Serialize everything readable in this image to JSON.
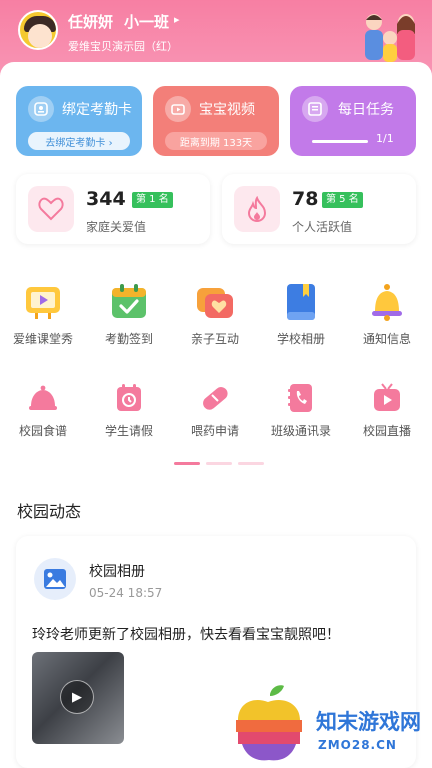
{
  "user": {
    "name": "任妍妍",
    "class": "小一班",
    "class_arrow": "▸",
    "school": "爱维宝贝演示园（红）"
  },
  "cards": [
    {
      "title": "绑定考勤卡",
      "sub": "去绑定考勤卡 ›",
      "icon": "attendance-card-icon"
    },
    {
      "title": "宝宝视频",
      "sub": "距离到期 133天",
      "icon": "video-icon"
    },
    {
      "title": "每日任务",
      "progress_text": "1/1",
      "icon": "task-icon"
    }
  ],
  "stats": [
    {
      "value": "344",
      "rank": "第 1 名",
      "label": "家庭关爱值"
    },
    {
      "value": "78",
      "rank": "第 5 名",
      "label": "个人活跃值"
    }
  ],
  "grid": [
    {
      "label": "爱维课堂秀",
      "icon": "classroom-show-icon"
    },
    {
      "label": "考勤签到",
      "icon": "attendance-calendar-icon"
    },
    {
      "label": "亲子互动",
      "icon": "chat-heart-icon"
    },
    {
      "label": "学校相册",
      "icon": "album-icon"
    },
    {
      "label": "通知信息",
      "icon": "bell-icon"
    },
    {
      "label": "校园食谱",
      "icon": "food-cloche-icon"
    },
    {
      "label": "学生请假",
      "icon": "leave-calendar-icon"
    },
    {
      "label": "喂药申请",
      "icon": "pill-icon"
    },
    {
      "label": "班级通讯录",
      "icon": "phonebook-icon"
    },
    {
      "label": "校园直播",
      "icon": "live-tv-icon"
    }
  ],
  "section_title": "校园动态",
  "feed": {
    "title": "校园相册",
    "time": "05-24 18:57",
    "text": "玲玲老师更新了校园相册，快去看看宝宝靓照吧！",
    "play_glyph": "▶"
  },
  "watermark": {
    "name": "知末游戏网",
    "url": "ZMO28.CN"
  },
  "colors": {
    "header": "#f77fa3",
    "card_blue": "#6cb6ef",
    "card_red": "#f37f79",
    "card_purple": "#c27ae9",
    "rank_green": "#36c05c",
    "accent_pink": "#f47a9d"
  }
}
